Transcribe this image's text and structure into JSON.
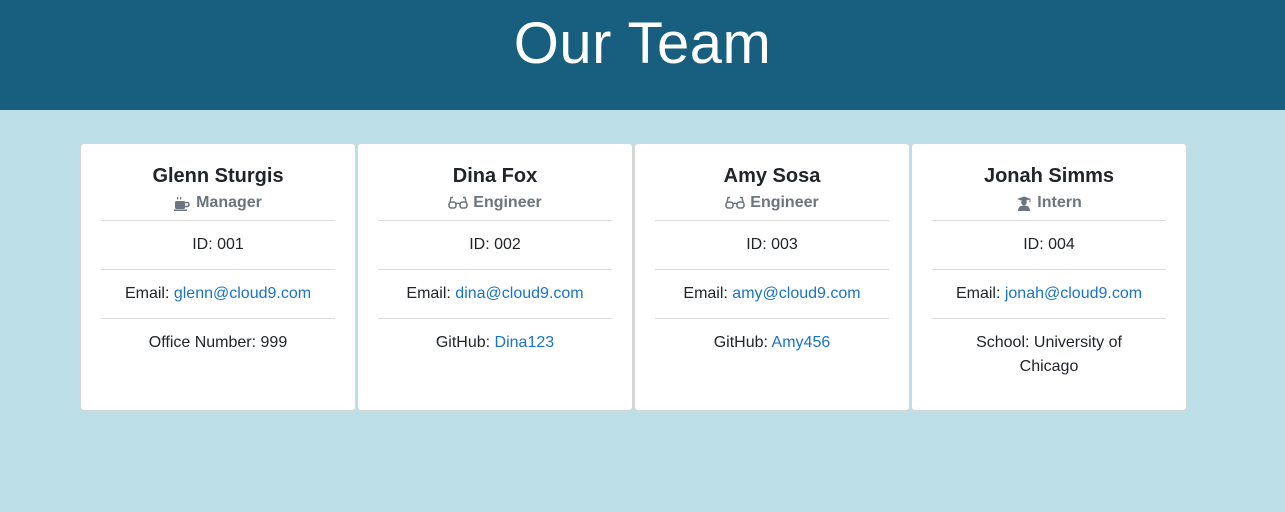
{
  "header": {
    "title": "Our Team"
  },
  "colors": {
    "header_bg": "#185f7f",
    "page_bg": "#bcdfe7",
    "link": "#1a73c9"
  },
  "cards": [
    {
      "name": "Glenn Sturgis",
      "role": "Manager",
      "role_icon": "coffee-mug-icon",
      "id_label": "ID: ",
      "id": "001",
      "email_label": "Email: ",
      "email": "glenn@cloud9.com",
      "extra_label": "Office Number: ",
      "extra": "999"
    },
    {
      "name": "Dina Fox",
      "role": "Engineer",
      "role_icon": "glasses-icon",
      "id_label": "ID: ",
      "id": "002",
      "email_label": "Email: ",
      "email": "dina@cloud9.com",
      "extra_label": "GitHub: ",
      "extra": "Dina123"
    },
    {
      "name": "Amy Sosa",
      "role": "Engineer",
      "role_icon": "glasses-icon",
      "id_label": "ID: ",
      "id": "003",
      "email_label": "Email: ",
      "email": "amy@cloud9.com",
      "extra_label": "GitHub: ",
      "extra": "Amy456"
    },
    {
      "name": "Jonah Simms",
      "role": "Intern",
      "role_icon": "graduate-icon",
      "id_label": "ID: ",
      "id": "004",
      "email_label": "Email: ",
      "email": "jonah@cloud9.com",
      "extra_label": "School: ",
      "extra": "University of Chicago"
    }
  ]
}
